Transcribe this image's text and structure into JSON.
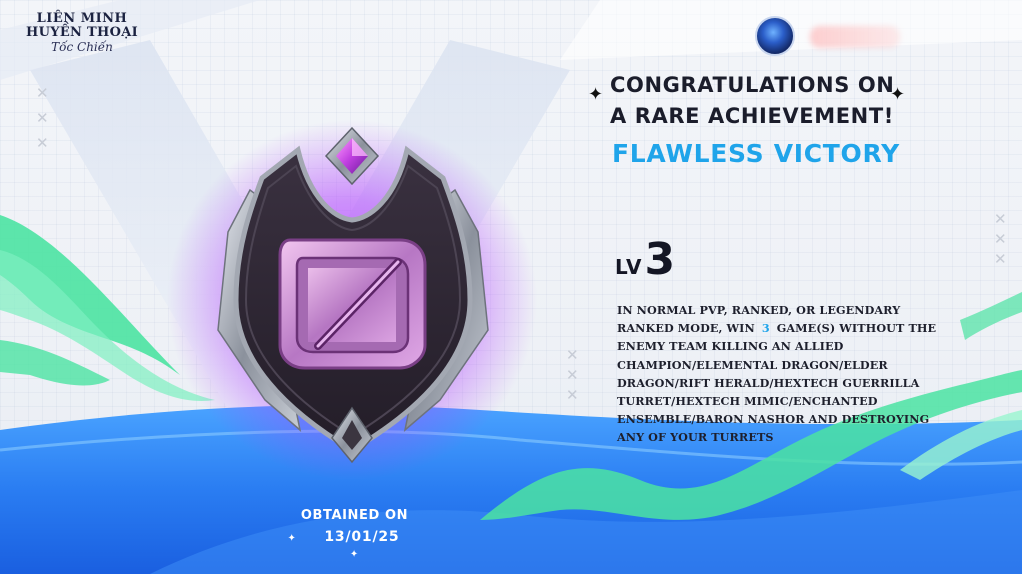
{
  "game": {
    "logo_line1": "LIÊN MINH",
    "logo_line2": "HUYỀN THOẠI",
    "logo_line3": "Tốc Chiến"
  },
  "achievement": {
    "congrats_line1": "CONGRATULATIONS ON",
    "congrats_line2": "A RARE ACHIEVEMENT!",
    "name": "FLAWLESS VICTORY",
    "level_label": "LV",
    "level_value": "3",
    "description_pre": "IN NORMAL PVP, RANKED, OR LEGENDARY RANKED MODE, WIN",
    "description_count": "3",
    "description_post": "GAME(S) WITHOUT THE ENEMY TEAM KILLING AN ALLIED CHAMPION/ELEMENTAL DRAGON/ELDER DRAGON/RIFT HERALD/HEXTECH GUERRILLA TURRET/HEXTECH MIMIC/ENCHANTED ENSEMBLE/BARON NASHOR AND DESTROYING ANY OF YOUR TURRETS",
    "obtained_label": "OBTAINED ON",
    "obtained_date": "13/01/25"
  },
  "icons": {
    "badge": "flawless-victory-badge-icon",
    "avatar": "player-avatar-icon",
    "sparkle": "sparkle-icon",
    "close_decor": "x-mark-icon"
  },
  "colors": {
    "accent_blue": "#1fa4ea",
    "badge_glow": "#b34dff",
    "badge_emblem": "#c98fd0",
    "wave_green": "#4be3a2",
    "floor_blue": "#2f7ff0"
  }
}
